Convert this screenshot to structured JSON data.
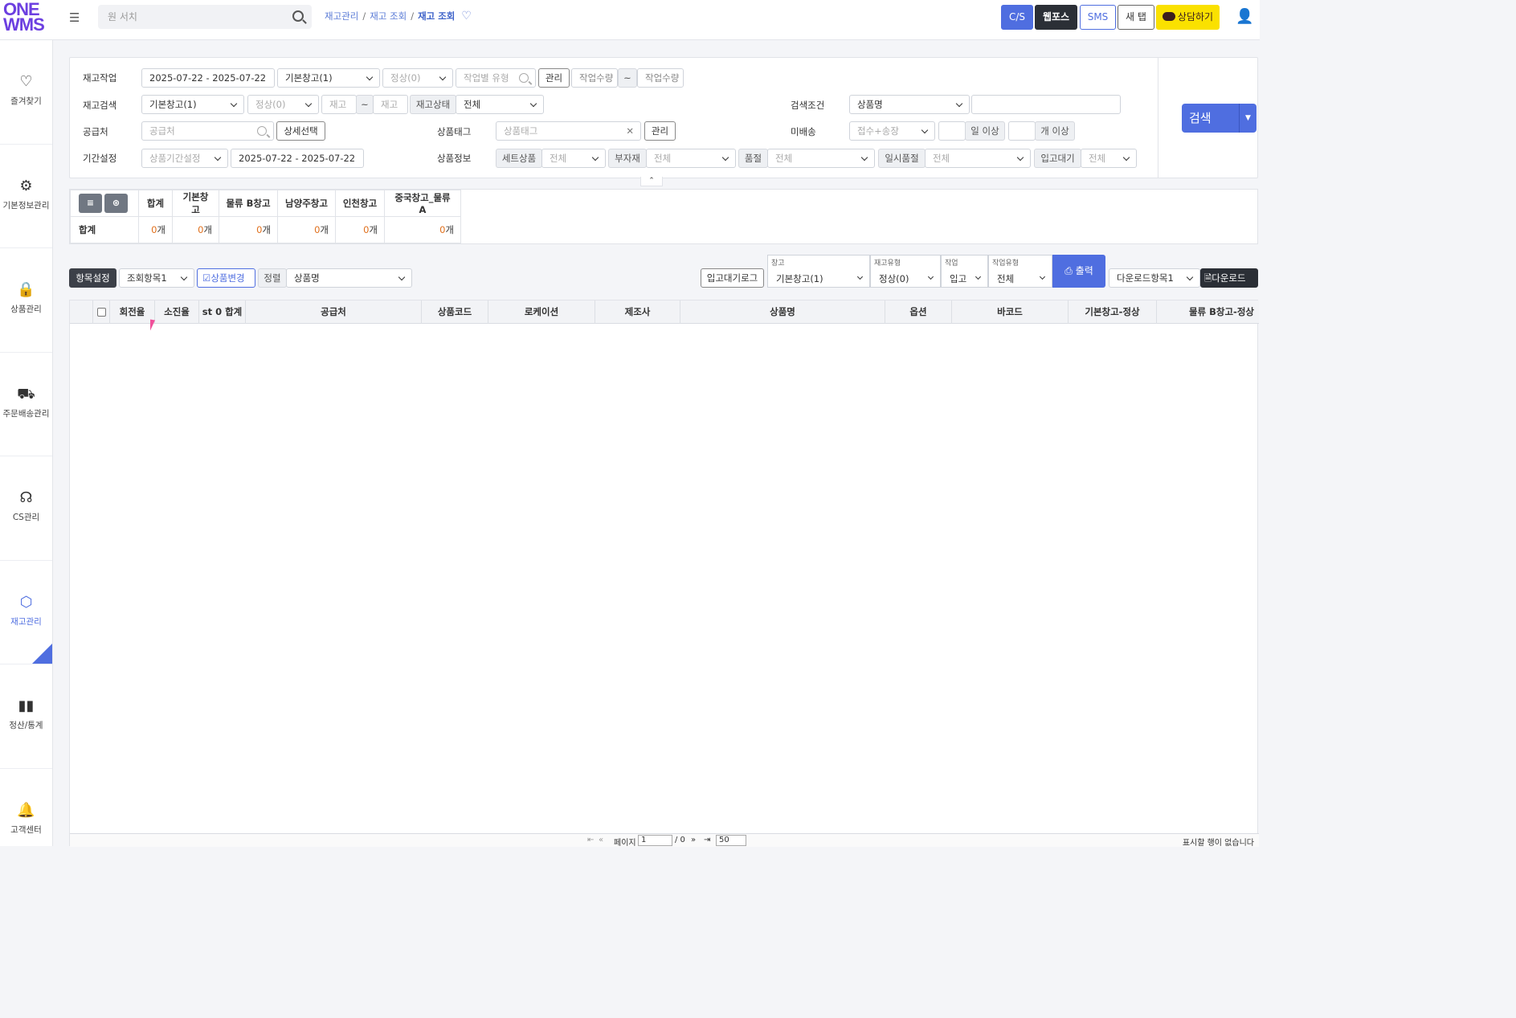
{
  "header": {
    "logo_line1": "ONE",
    "logo_line2": "WMS",
    "search_placeholder": "원 서치",
    "breadcrumb": [
      "재고관리",
      "재고 조회",
      "재고 조회"
    ],
    "buttons": {
      "cs": "C/S",
      "webpos": "웹포스",
      "sms": "SMS",
      "newtab": "새 탭",
      "consult": "상담하기"
    }
  },
  "sidebar": [
    {
      "label": "즐겨찾기",
      "icon": "heart-icon"
    },
    {
      "label": "기본정보관리",
      "icon": "gear-icon"
    },
    {
      "label": "상품관리",
      "icon": "bag-icon"
    },
    {
      "label": "주문배송관리",
      "icon": "truck-icon"
    },
    {
      "label": "CS관리",
      "icon": "headset-icon"
    },
    {
      "label": "재고관리",
      "icon": "cube-icon"
    },
    {
      "label": "정산/통계",
      "icon": "bar-chart-icon"
    },
    {
      "label": "고객센터",
      "icon": "bell-icon"
    }
  ],
  "filters": {
    "row1": {
      "label": "재고작업",
      "date": "2025-07-22 - 2025-07-22",
      "warehouse": "기본창고(1)",
      "status": "정상(0)",
      "work_type_placeholder": "작업별 유형",
      "manage": "관리",
      "qty_from": "작업수량",
      "tilde": "~",
      "qty_to": "작업수량"
    },
    "row2": {
      "label": "재고검색",
      "warehouse": "기본창고(1)",
      "status": "정상(0)",
      "stock_from": "재고",
      "tilde": "~",
      "stock_to": "재고",
      "stock_state_label": "재고상태",
      "stock_state": "전체",
      "cond_label": "검색조건",
      "cond": "상품명",
      "cond_value": ""
    },
    "row3": {
      "label": "공급처",
      "supplier_placeholder": "공급처",
      "detail": "상세선택",
      "tag_label": "상품태그",
      "tag_placeholder": "상품태그",
      "tag_manage": "관리",
      "undelivered_label": "미배송",
      "undelivered": "접수+송장",
      "days": "일 이상",
      "count": "개 이상"
    },
    "row4": {
      "label": "기간설정",
      "period_placeholder": "상품기간설정",
      "date": "2025-07-22 - 2025-07-22",
      "info_label": "상품정보",
      "set_label": "세트상품",
      "set": "전체",
      "sub_label": "부자재",
      "sub": "전체",
      "soldout_label": "품절",
      "soldout": "전체",
      "tempsold_label": "일시품절",
      "tempsold": "전체",
      "wait_label": "입고대기",
      "wait": "전체"
    },
    "search": "검색"
  },
  "summary": {
    "headers": [
      "합계",
      "기본창고",
      "물류 B창고",
      "남양주창고",
      "인천창고",
      "중국창고_물류A"
    ],
    "row_label": "합계",
    "values": [
      "0",
      "0",
      "0",
      "0",
      "0",
      "0"
    ],
    "unit": "개"
  },
  "toolbar": {
    "item_setting": "항목설정",
    "view_item": "조회항목1",
    "product_change": "상품변경",
    "sort_label": "정렬",
    "sort": "상품명",
    "wait_log": "입고대기로그",
    "warehouse_label": "창고",
    "warehouse": "기본창고(1)",
    "stock_type_label": "재고유형",
    "stock_type": "정상(0)",
    "work_label": "작업",
    "work": "입고",
    "work_type_label": "작업유형",
    "work_type": "전체",
    "print": "출력",
    "download_item": "다운로드항목1",
    "download": "다운로드"
  },
  "grid": {
    "columns": [
      "회전율",
      "소진율",
      "st 0 합계",
      "공급처",
      "상품코드",
      "로케이션",
      "제조사",
      "상품명",
      "옵션",
      "바코드",
      "기본창고-정상",
      "물류 B창고-정상"
    ]
  },
  "pager": {
    "page_label": "페이지",
    "page": "1",
    "total": "/ 0",
    "per_page": "50",
    "empty": "표시할 행이 없습니다"
  }
}
